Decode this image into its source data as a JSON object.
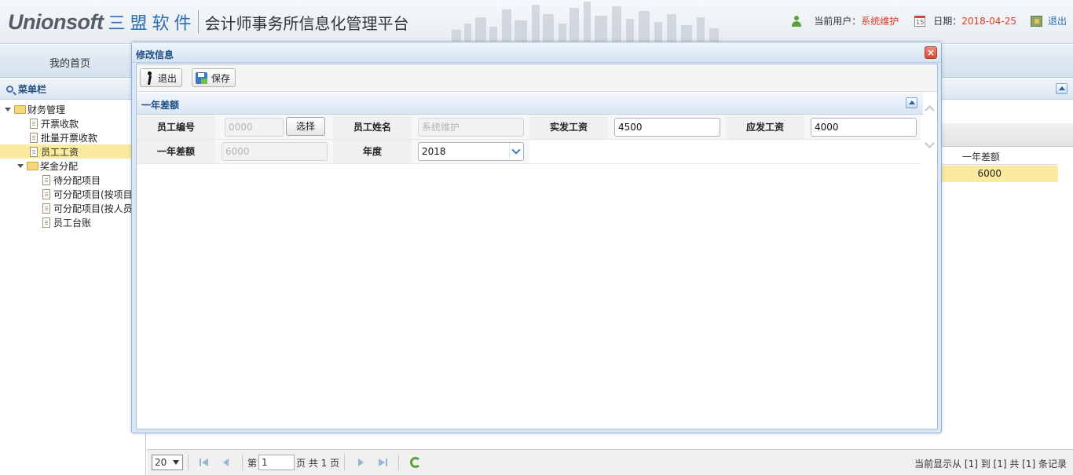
{
  "header": {
    "logo_brand": "Unionsoft",
    "logo_cn": "三盟软件",
    "platform_title": "会计师事务所信息化管理平台",
    "current_user_label": "当前用户：",
    "current_user": "系统维护",
    "date_label": "日期：",
    "date": "2018-04-25",
    "logout": "退出",
    "calendar_icon_text": "15"
  },
  "nav": {
    "home": "我的首页"
  },
  "sidebar": {
    "title": "菜单栏",
    "tree": [
      {
        "label": "财务管理",
        "type": "folder",
        "level": 0,
        "expanded": true
      },
      {
        "label": "开票收款",
        "type": "file",
        "level": 1
      },
      {
        "label": "批量开票收款",
        "type": "file",
        "level": 1
      },
      {
        "label": "员工工资",
        "type": "file",
        "level": 1,
        "selected": true
      },
      {
        "label": "奖金分配",
        "type": "folder",
        "level": 1,
        "expanded": true
      },
      {
        "label": "待分配项目",
        "type": "file",
        "level": 2
      },
      {
        "label": "可分配项目(按项目",
        "type": "file",
        "level": 2
      },
      {
        "label": "可分配项目(按人员",
        "type": "file",
        "level": 2
      },
      {
        "label": "员工台账",
        "type": "file",
        "level": 2
      }
    ]
  },
  "background_grid": {
    "column_header": "一年差额",
    "row_value": "6000"
  },
  "dialog": {
    "title": "修改信息",
    "toolbar": {
      "exit": "退出",
      "save": "保存"
    },
    "section_title": "一年差额",
    "form": {
      "employee_no_label": "员工编号",
      "employee_no_value": "0000",
      "select_button": "选择",
      "employee_name_label": "员工姓名",
      "employee_name_value": "系统维护",
      "actual_salary_label": "实发工资",
      "actual_salary_value": "4500",
      "due_salary_label": "应发工资",
      "due_salary_value": "4000",
      "annual_diff_label": "一年差额",
      "annual_diff_value": "6000",
      "year_label": "年度",
      "year_value": "2018"
    }
  },
  "pager": {
    "page_size": "20",
    "page_prefix": "第",
    "page_value": "1",
    "page_suffix": "页 共 1 页",
    "status": "当前显示从 [1] 到 [1] 共 [1] 条记录"
  },
  "colors": {
    "accent": "#1f4e84",
    "highlight_red": "#e03c28",
    "selection": "#fbeb9e"
  }
}
